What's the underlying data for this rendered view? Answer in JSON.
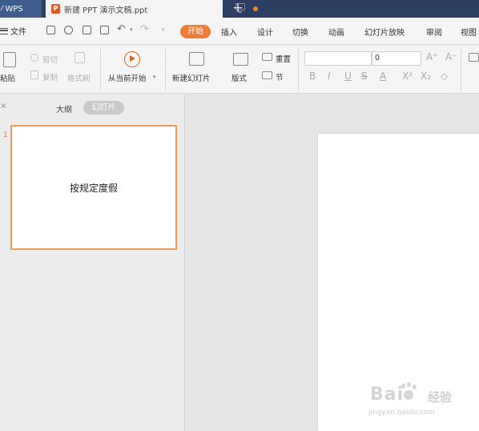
{
  "title_bar": {
    "app_tab": "WPS",
    "doc_tab": "新建 PPT 演示文稿.ppt",
    "doc_badge": "P",
    "new_tab": "+"
  },
  "menu": {
    "file": "文件",
    "active": "开始",
    "items": [
      "插入",
      "设计",
      "切换",
      "动画",
      "幻灯片放映",
      "审阅",
      "视图"
    ]
  },
  "ribbon": {
    "paste": "粘贴",
    "cut": "剪切",
    "copy": "复制",
    "format_painter": "格式刷",
    "play_from_current": "从当前开始",
    "new_slide": "新建幻灯片",
    "layout": "版式",
    "reset": "重置",
    "section": "节",
    "font_size": "0",
    "grow": "A⁺",
    "shrink": "A⁻",
    "bold": "B",
    "italic": "I",
    "underline": "U",
    "strike": "S",
    "font_color": "A",
    "superscript": "X²",
    "subscript": "X₂",
    "clear": "◇"
  },
  "left_pane": {
    "tab_outline": "大纲",
    "tab_slides": "幻灯片",
    "close": "×"
  },
  "slides": [
    {
      "number": "1",
      "text": "按规定度假"
    }
  ],
  "watermark": {
    "brand": "Bai",
    "brand2": "经验",
    "url": "jingyan.baidu.com"
  }
}
